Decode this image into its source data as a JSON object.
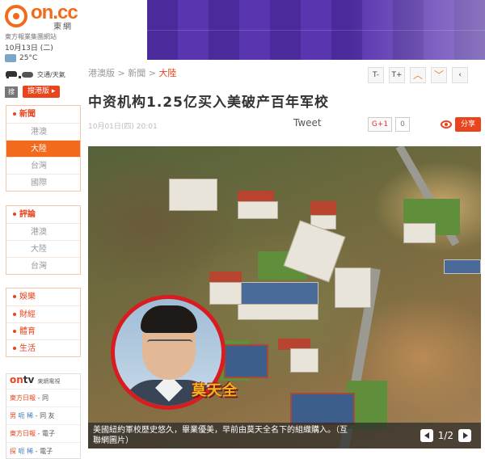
{
  "site": {
    "logo_text": "on.cc",
    "logo_sub": "東網",
    "slogan": "東方報業集團網站",
    "date": "10月13日 (二)",
    "temperature": "25°C",
    "traffic_label": "交通/天氣",
    "search_toggle": "搜",
    "search_button": "搜港版 ▸"
  },
  "breadcrumb": {
    "items": [
      "港澳版",
      "新聞",
      "大陸"
    ],
    "separator": " > "
  },
  "tools": {
    "font_down": "T-",
    "font_up": "T+",
    "up_icon": "︿",
    "down_icon": "﹀",
    "back_icon": "‹"
  },
  "article": {
    "title": "中资机构1.25亿买入美破产百年军校",
    "date": "10月01日(四) 20:01",
    "tweet_label": "Tweet",
    "gplus_label": "G+1",
    "gplus_count": "0",
    "share_label": "分享"
  },
  "sidebar": {
    "group1": {
      "head": "新聞",
      "items": [
        "港澳",
        "大陸",
        "台灣",
        "國際"
      ],
      "active": "大陸"
    },
    "group2": {
      "head": "評論",
      "items": [
        "港澳",
        "大陸",
        "台灣"
      ]
    },
    "group3": {
      "items": [
        "娛樂",
        "財經",
        "體育",
        "生活"
      ]
    },
    "ontv": {
      "logo_a": "on",
      "logo_b": "tv",
      "sub": "東網電視",
      "items": [
        {
          "a": "東方日報",
          "b": "",
          "c": "- 同"
        },
        {
          "a": "男",
          "b": "呃 稀",
          "c": "- 同 友"
        },
        {
          "a": "東方日報",
          "b": "",
          "c": "- 電子"
        },
        {
          "a": "探",
          "b": "呃 稀",
          "c": "- 電子"
        }
      ]
    }
  },
  "photo": {
    "name_tag": "莫天全",
    "caption": "美國紐約軍校歷史悠久，畢業優美，早前由莫天全名下的組織購入。（互聯網圖片）",
    "page": "1/2"
  },
  "colors": {
    "brand_orange": "#f26a1b",
    "accent_red": "#e8451e",
    "banner_purple": "#4b2a9c",
    "portrait_ring": "#d71d20",
    "name_tag": "#f2b51f"
  }
}
